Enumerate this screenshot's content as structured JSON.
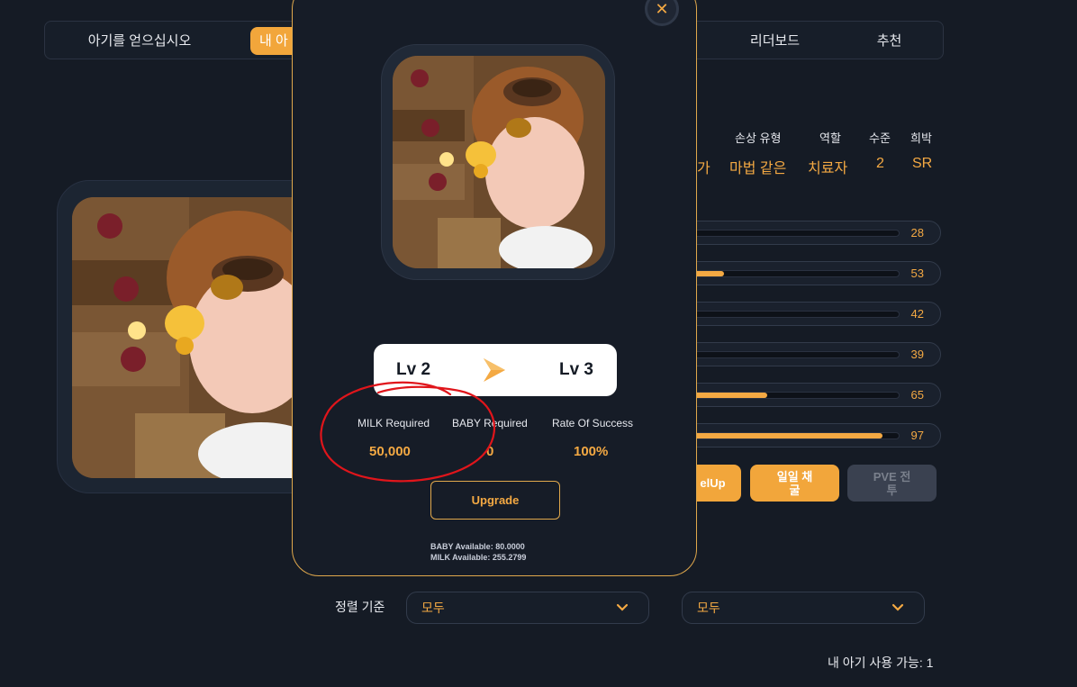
{
  "tabs": [
    {
      "label": "아기를 얻으십시오"
    },
    {
      "label": "내 아"
    },
    {
      "label": "리더보드"
    },
    {
      "label": "추천"
    }
  ],
  "stats": {
    "headers": [
      "손상 유형",
      "역할",
      "수준",
      "희박"
    ],
    "values": [
      "마법 같은",
      "치료자",
      "2",
      "SR"
    ],
    "partial_value": "가"
  },
  "bars": [
    {
      "value": "28",
      "fill": 0.0
    },
    {
      "value": "53",
      "fill": 0.15
    },
    {
      "value": "42",
      "fill": 0.0
    },
    {
      "value": "39",
      "fill": 0.0
    },
    {
      "value": "65",
      "fill": 0.36
    },
    {
      "value": "97",
      "fill": 0.92
    }
  ],
  "actions": {
    "levelup": "elUp",
    "daily": "일일 채\n굴",
    "pve": "PVE 전\n투"
  },
  "sort": {
    "label": "정렬 기준",
    "select1": "모두",
    "select2": "모두"
  },
  "available": "내 아기 사용 가능:  1",
  "modal": {
    "close": "✕",
    "from_level": "Lv 2",
    "to_level": "Lv 3",
    "milk_label": "MILK Required",
    "milk_value": "50,000",
    "baby_label": "BABY Required",
    "baby_value": "0",
    "rate_label": "Rate Of Success",
    "rate_value": "100%",
    "upgrade": "Upgrade",
    "baby_available": "BABY Available: 80.0000",
    "milk_available": "MILK Available: 255.2799"
  },
  "colors": {
    "accent": "#f4a943",
    "annotation": "#e0151b"
  }
}
